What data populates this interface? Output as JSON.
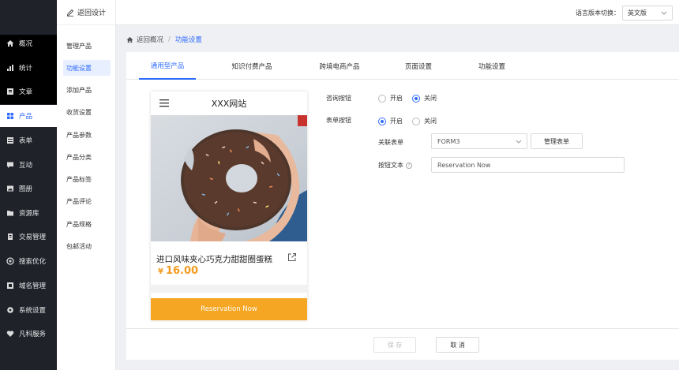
{
  "sidebar": {
    "items": [
      {
        "label": "概况",
        "icon": "home-icon"
      },
      {
        "label": "统计",
        "icon": "chart-icon"
      },
      {
        "label": "文章",
        "icon": "article-icon"
      },
      {
        "label": "产品",
        "icon": "grid-icon"
      },
      {
        "label": "表单",
        "icon": "form-icon"
      },
      {
        "label": "互动",
        "icon": "chat-icon"
      },
      {
        "label": "图册",
        "icon": "image-icon"
      },
      {
        "label": "资源库",
        "icon": "folder-icon"
      },
      {
        "label": "交易管理",
        "icon": "trade-icon"
      },
      {
        "label": "搜索优化",
        "icon": "search-icon"
      },
      {
        "label": "域名管理",
        "icon": "domain-icon"
      },
      {
        "label": "系统设置",
        "icon": "gear-icon"
      },
      {
        "label": "凡科服务",
        "icon": "heart-icon"
      }
    ],
    "active_index": 3
  },
  "subnav": {
    "back_label": "返回设计",
    "items": [
      "管理产品",
      "功能设置",
      "添加产品",
      "收货设置",
      "产品参数",
      "产品分类",
      "产品标签",
      "产品评论",
      "产品规格",
      "包邮活动"
    ],
    "active_index": 1
  },
  "topbar": {
    "lang_label": "语言版本切换：",
    "lang_value": "英文版"
  },
  "breadcrumb": {
    "home": "返回概况",
    "current": "功能设置"
  },
  "tabs": [
    "通用型产品",
    "知识付费产品",
    "跨境电商产品",
    "页面设置",
    "功能设置"
  ],
  "active_tab": 0,
  "preview": {
    "site_name": "XXX网站",
    "product_title": "进口风味夹心巧克力甜甜圈蛋糕",
    "currency": "¥",
    "price": "16.00",
    "reserve_label": "Reservation Now"
  },
  "form": {
    "consult_label": "咨询按钮",
    "form_btn_label": "表单按钮",
    "on_label": "开启",
    "off_label": "关闭",
    "consult_value": "关闭",
    "form_btn_value": "开启",
    "linked_form_label": "关联表单",
    "linked_form_value": "FORM3",
    "manage_form_label": "管理表单",
    "btn_text_label": "按钮文本",
    "btn_text_value": "Reservation Now"
  },
  "footer": {
    "save_label": "保 存",
    "cancel_label": "取 消"
  },
  "colors": {
    "accent": "#2f6bff",
    "price": "#f29a1d",
    "reserve_bg": "#f5a623",
    "sidebar_bg": "#1f2229"
  }
}
